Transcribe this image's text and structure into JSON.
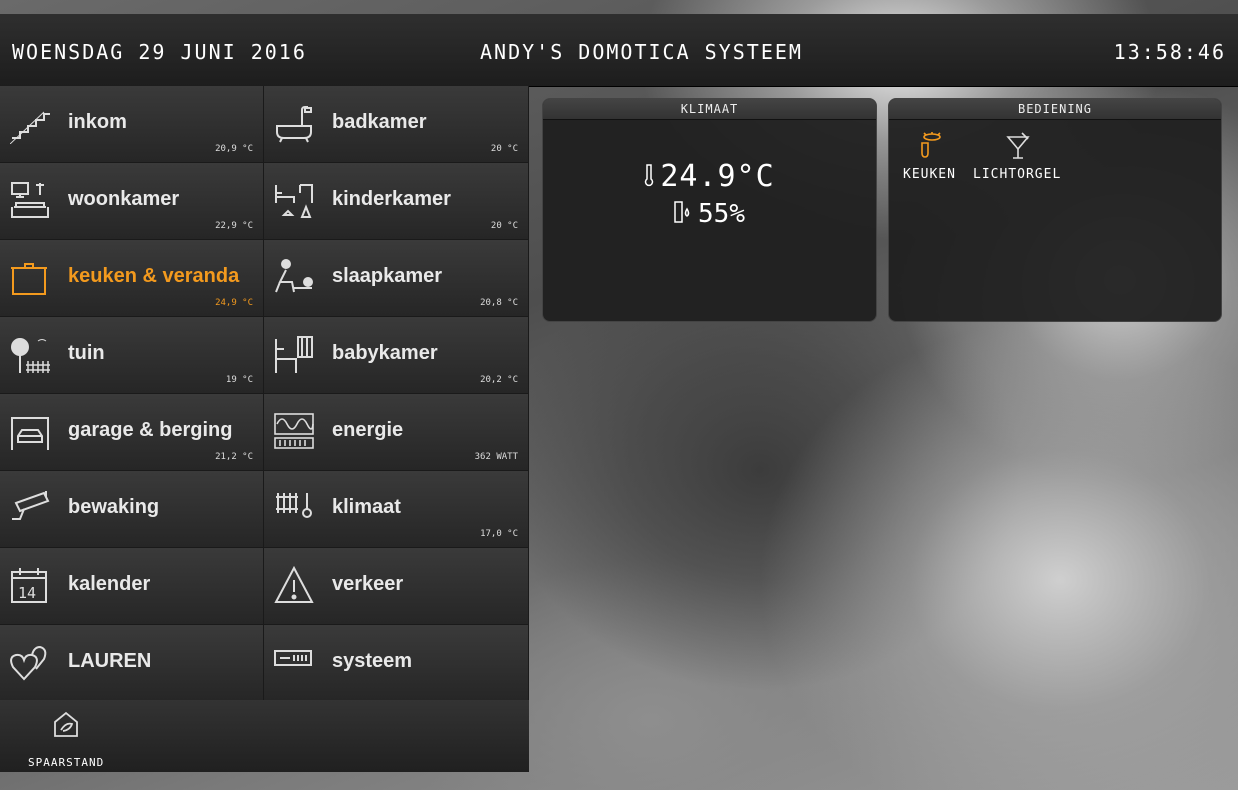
{
  "header": {
    "date": "WOENSDAG 29 JUNI 2016",
    "title": "ANDY'S DOMOTICA SYSTEEM",
    "clock": "13:58:46"
  },
  "rooms": [
    {
      "name": "inkom",
      "temp": "20,9 °C",
      "icon": "stairs-icon"
    },
    {
      "name": "badkamer",
      "temp": "20 °C",
      "icon": "bathtub-icon"
    },
    {
      "name": "woonkamer",
      "temp": "22,9 °C",
      "icon": "sofa-tv-icon"
    },
    {
      "name": "kinderkamer",
      "temp": "20 °C",
      "icon": "kids-bed-icon"
    },
    {
      "name": "keuken & veranda",
      "temp": "24,9 °C",
      "icon": "cooking-pot-icon"
    },
    {
      "name": "slaapkamer",
      "temp": "20,8 °C",
      "icon": "bedroom-icon"
    },
    {
      "name": "tuin",
      "temp": "19 °C",
      "icon": "tree-fence-icon"
    },
    {
      "name": "babykamer",
      "temp": "20,2 °C",
      "icon": "crib-icon"
    },
    {
      "name": "garage & berging",
      "temp": "21,2 °C",
      "icon": "garage-car-icon"
    },
    {
      "name": "energie",
      "temp": "362 WATT",
      "icon": "energy-meter-icon"
    },
    {
      "name": "bewaking",
      "temp": "",
      "icon": "security-camera-icon"
    },
    {
      "name": "klimaat",
      "temp": "17,0 °C",
      "icon": "radiator-thermometer-icon"
    },
    {
      "name": "kalender",
      "temp": "",
      "icon": "calendar-icon"
    },
    {
      "name": "verkeer",
      "temp": "",
      "icon": "warning-triangle-icon"
    },
    {
      "name": "LAUREN",
      "temp": "",
      "icon": "hearts-icon"
    },
    {
      "name": "systeem",
      "temp": "",
      "icon": "system-device-icon"
    }
  ],
  "active_room": "keuken & veranda",
  "footer": {
    "eco_label": "SPAARSTAND",
    "eco_icon": "eco-house-icon"
  },
  "climate_panel": {
    "title": "KLIMAAT",
    "temperature": "24.9°C",
    "humidity": "55%"
  },
  "controls_panel": {
    "title": "BEDIENING",
    "items": [
      {
        "label": "KEUKEN",
        "icon": "ceiling-lamp-icon",
        "state": "on"
      },
      {
        "label": "LICHTORGEL",
        "icon": "cocktail-icon",
        "state": "off"
      }
    ]
  },
  "colors": {
    "accent": "#f39a1e",
    "tile_bg": "#2e2e2e",
    "header_bg": "#262626"
  }
}
